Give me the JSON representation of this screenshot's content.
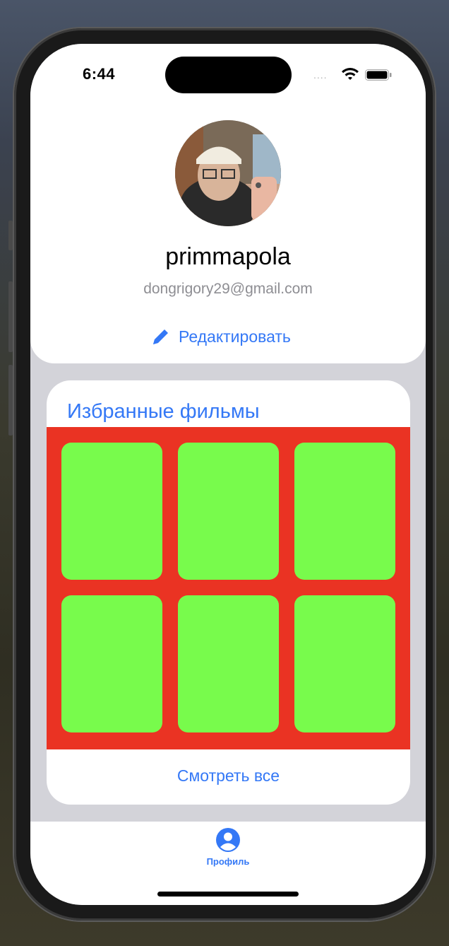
{
  "status_bar": {
    "time": "6:44",
    "signal": "....",
    "icons": [
      "wifi-icon",
      "battery-icon"
    ]
  },
  "profile": {
    "username": "primmapola",
    "email": "dongrigory29@gmail.com",
    "edit_label": "Редактировать",
    "edit_icon": "pencil-icon"
  },
  "favorites": {
    "title": "Избранные фильмы",
    "posters": [
      "",
      "",
      "",
      "",
      "",
      ""
    ],
    "see_all_label": "Смотреть все"
  },
  "tabbar": {
    "items": [
      {
        "label": "Профиль",
        "icon": "person-circle-icon",
        "active": true
      }
    ]
  },
  "colors": {
    "accent": "#3478f6",
    "grid_background": "#ea3323",
    "poster_placeholder": "#78fb4c"
  }
}
